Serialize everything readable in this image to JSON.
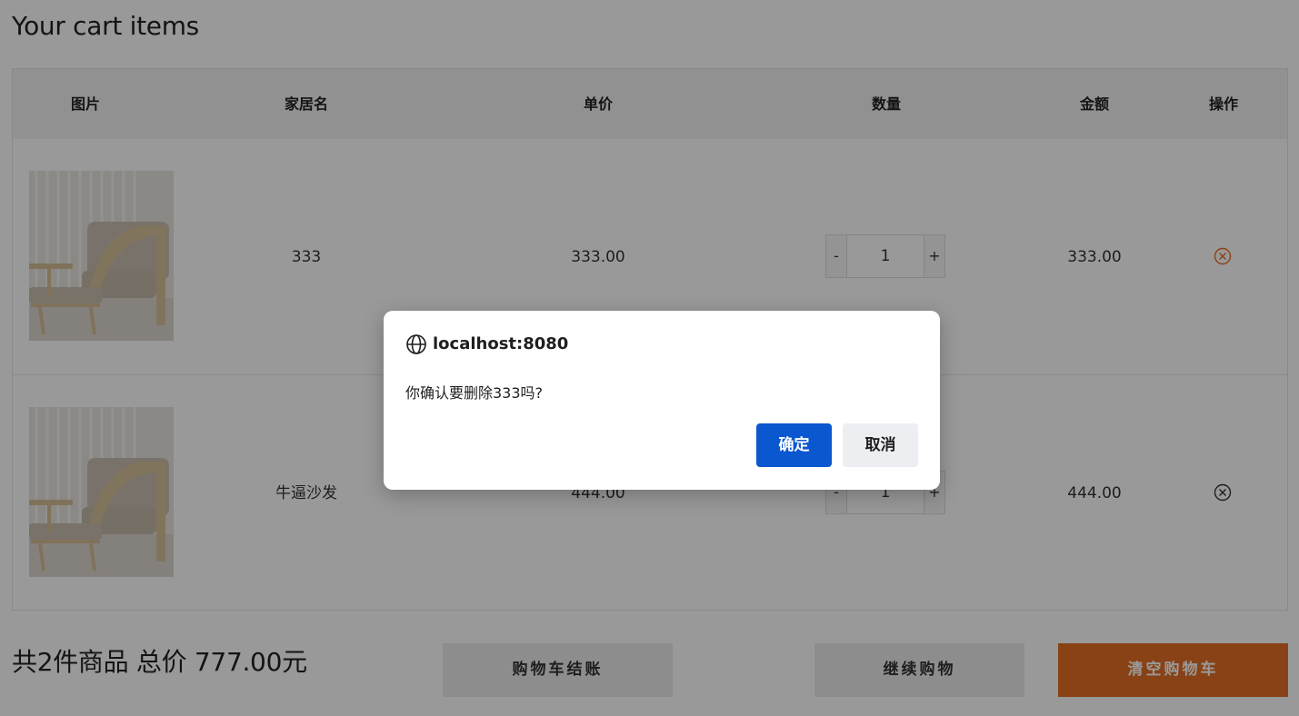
{
  "page": {
    "title": "Your cart items"
  },
  "table": {
    "headers": [
      "图片",
      "家居名",
      "单价",
      "数量",
      "金额",
      "操作"
    ],
    "rows": [
      {
        "name": "333",
        "price": "333.00",
        "quantity": "1",
        "amount": "333.00",
        "remove_icon": "close-circle-icon"
      },
      {
        "name": "牛逼沙发",
        "price": "444.00",
        "quantity": "1",
        "amount": "444.00",
        "remove_icon": "close-circle-icon"
      }
    ],
    "minus_label": "-",
    "plus_label": "+"
  },
  "summary": {
    "text": "共2件商品 总价 777.00元"
  },
  "actions": {
    "checkout": "购物车结账",
    "continue": "继续购物",
    "clear": "清空购物车"
  },
  "dialog": {
    "origin": "localhost:8080",
    "message": "你确认要删除333吗?",
    "ok": "确定",
    "cancel": "取消"
  },
  "colors": {
    "accent": "#e46f24",
    "dialog_primary": "#0b57d0",
    "remove_active": "#e46f24"
  }
}
